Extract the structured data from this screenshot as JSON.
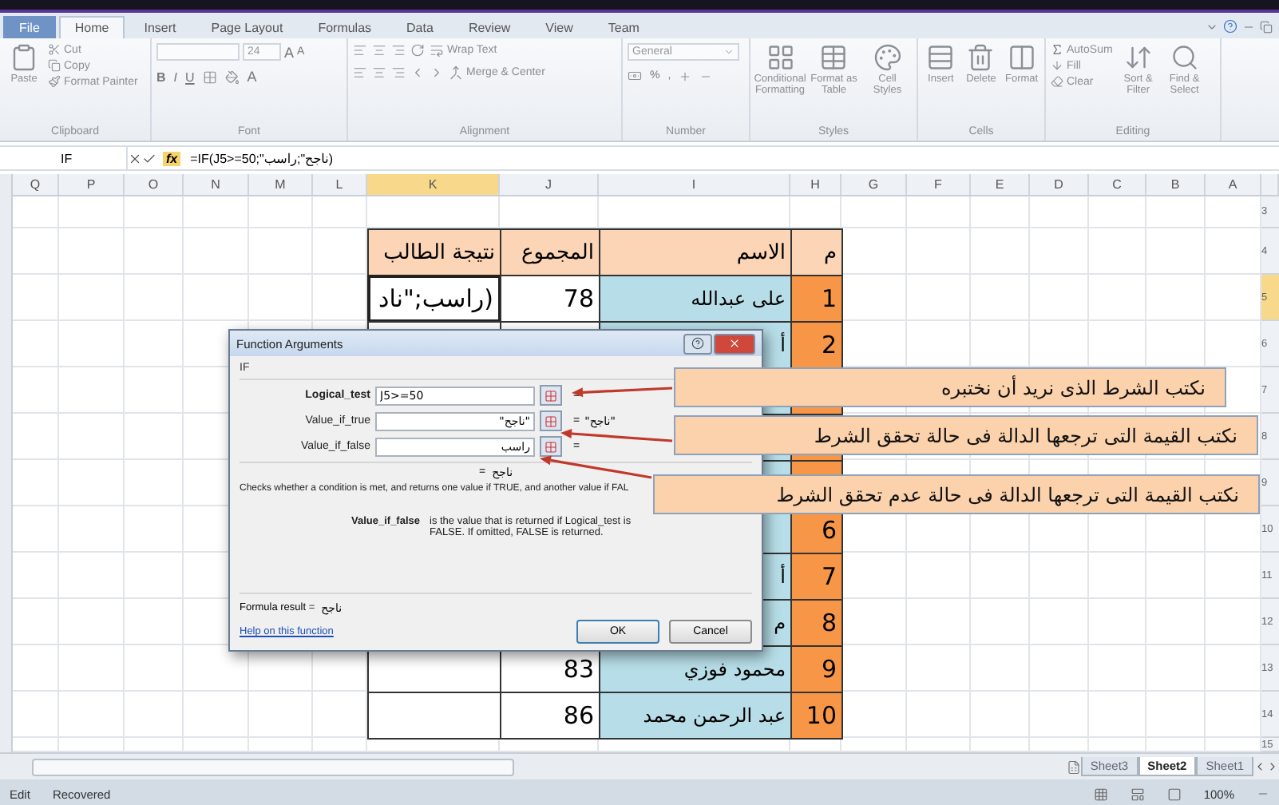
{
  "ribbon_tabs": [
    {
      "label": "File",
      "kind": "file",
      "selected": false
    },
    {
      "label": "Home",
      "kind": "tab",
      "selected": true
    },
    {
      "label": "Insert",
      "kind": "tab",
      "selected": false
    },
    {
      "label": "Page Layout",
      "kind": "tab",
      "selected": false
    },
    {
      "label": "Formulas",
      "kind": "tab",
      "selected": false
    },
    {
      "label": "Data",
      "kind": "tab",
      "selected": false
    },
    {
      "label": "Review",
      "kind": "tab",
      "selected": false
    },
    {
      "label": "View",
      "kind": "tab",
      "selected": false
    },
    {
      "label": "Team",
      "kind": "tab",
      "selected": false
    }
  ],
  "ribbon": {
    "clipboard": {
      "label": "Clipboard",
      "paste": "Paste",
      "cut": "Cut",
      "copy": "Copy",
      "format_painter": "Format Painter"
    },
    "font": {
      "label": "Font",
      "size": "24",
      "grow": "A",
      "shrink": "A",
      "bold": "B",
      "italic": "I",
      "underline": "U",
      "font_color": "A"
    },
    "alignment": {
      "label": "Alignment",
      "wrap_text": "Wrap Text",
      "merge_center": "Merge & Center"
    },
    "number": {
      "label": "Number",
      "format": "General",
      "percent": "%",
      "comma": ","
    },
    "styles": {
      "label": "Styles",
      "buttons": [
        "Conditional Formatting",
        "Format as Table",
        "Cell Styles"
      ]
    },
    "cells": {
      "label": "Cells",
      "buttons": [
        "Insert",
        "Delete",
        "Format"
      ]
    },
    "editing": {
      "label": "Editing",
      "autosum": "AutoSum",
      "fill": "Fill",
      "clear": "Clear",
      "buttons": [
        "Sort & Filter",
        "Find & Select"
      ]
    }
  },
  "formula_bar": {
    "name_box": "IF",
    "function_button": "fx",
    "formula": "=IF(J5>=50;\"ناجح\";راسب)"
  },
  "columns": [
    {
      "label": "Q",
      "selected": false
    },
    {
      "label": "P",
      "selected": false
    },
    {
      "label": "O",
      "selected": false
    },
    {
      "label": "N",
      "selected": false
    },
    {
      "label": "M",
      "selected": false
    },
    {
      "label": "L",
      "selected": false
    },
    {
      "label": "K",
      "selected": true
    },
    {
      "label": "J",
      "selected": false
    },
    {
      "label": "I",
      "selected": false
    },
    {
      "label": "H",
      "selected": false
    },
    {
      "label": "G",
      "selected": false
    },
    {
      "label": "F",
      "selected": false
    },
    {
      "label": "E",
      "selected": false
    },
    {
      "label": "D",
      "selected": false
    },
    {
      "label": "C",
      "selected": false
    },
    {
      "label": "B",
      "selected": false
    },
    {
      "label": "A",
      "selected": false
    }
  ],
  "row_numbers": [
    {
      "label": "3",
      "selected": false
    },
    {
      "label": "4",
      "selected": false
    },
    {
      "label": "5",
      "selected": true
    },
    {
      "label": "6",
      "selected": false
    },
    {
      "label": "7",
      "selected": false
    },
    {
      "label": "8",
      "selected": false
    },
    {
      "label": "9",
      "selected": false
    },
    {
      "label": "10",
      "selected": false
    },
    {
      "label": "11",
      "selected": false
    },
    {
      "label": "12",
      "selected": false
    },
    {
      "label": "13",
      "selected": false
    },
    {
      "label": "14",
      "selected": false
    },
    {
      "label": "15",
      "selected": false
    }
  ],
  "table": {
    "headers": [
      "م",
      "الاسم",
      "المجموع",
      "نتيجة الطالب"
    ],
    "rows": [
      {
        "result": "(راسب;\"ناد",
        "total": "78",
        "name": "على عبدالله",
        "number": "1",
        "active": true
      },
      {
        "name": "أ",
        "number": "2"
      },
      {},
      {},
      {},
      {
        "number": "6"
      },
      {
        "name": "أ",
        "number": "7"
      },
      {
        "name": "م",
        "number": "8"
      },
      {
        "total": "83",
        "name": "محمود فوزي",
        "number": "9"
      },
      {
        "total": "86",
        "name": "عبد الرحمن محمد",
        "number": "10"
      }
    ]
  },
  "dialog": {
    "title": "Function Arguments",
    "function_name": "IF",
    "arguments": [
      {
        "label": "Logical_test",
        "required": true,
        "value": "J5>=50",
        "equals": "="
      },
      {
        "label": "Value_if_true",
        "required": false,
        "value": "\"ناجح\"",
        "equals": "=",
        "result": "\"ناجح\""
      },
      {
        "label": "Value_if_false",
        "required": false,
        "value": "راسب",
        "equals": "="
      }
    ],
    "overall": {
      "equals": "=",
      "value": "ناجح"
    },
    "description": "Checks whether a condition is met, and returns one value if TRUE, and another value if FAL",
    "argument_help": {
      "name": "Value_if_false",
      "text": "is the value that is returned if Logical_test is FALSE. If omitted, FALSE is returned."
    },
    "formula_result_label": "Formula result =",
    "formula_result": "ناجح",
    "help_link": "Help on this function",
    "buttons": [
      {
        "label": "OK",
        "default": true
      },
      {
        "label": "Cancel",
        "default": false
      }
    ]
  },
  "callouts": [
    {
      "text": "نكتب الشرط الذى نريد أن نختبره"
    },
    {
      "text": "نكتب القيمة التى ترجعها الدالة فى حالة تحقق الشرط"
    },
    {
      "text": "نكتب القيمة التى ترجعها الدالة فى حالة عدم تحقق الشرط"
    }
  ],
  "sheet_tabs": [
    {
      "label": "Sheet3",
      "selected": false
    },
    {
      "label": "Sheet2",
      "selected": true
    },
    {
      "label": "Sheet1",
      "selected": false
    }
  ],
  "status_bar": {
    "mode": "Edit",
    "state": "Recovered",
    "zoom": "100%"
  }
}
